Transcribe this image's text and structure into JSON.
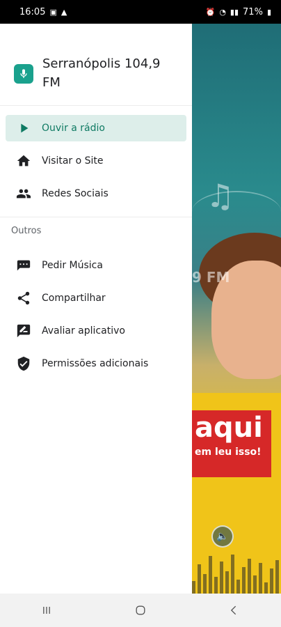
{
  "status_bar": {
    "time": "16:05",
    "battery": "71%"
  },
  "app": {
    "title": "Serranópolis 104,9 FM",
    "logo_icon": "microphone-icon",
    "accent": "#1aa18d"
  },
  "menu": {
    "primary": [
      {
        "label": "Ouvir a rádio",
        "icon": "play-icon",
        "active": true
      },
      {
        "label": "Visitar o Site",
        "icon": "home-icon",
        "active": false
      },
      {
        "label": "Redes Sociais",
        "icon": "people-icon",
        "active": false
      }
    ],
    "section_label": "Outros",
    "secondary": [
      {
        "label": "Pedir Música",
        "icon": "message-icon"
      },
      {
        "label": "Compartilhar",
        "icon": "share-icon"
      },
      {
        "label": "Avaliar aplicativo",
        "icon": "rate-review-icon"
      },
      {
        "label": "Permissões adicionais",
        "icon": "shield-check-icon"
      }
    ]
  },
  "background": {
    "freq_text": "9 FM",
    "banner_big": "aqui",
    "banner_small": "em leu isso!"
  }
}
